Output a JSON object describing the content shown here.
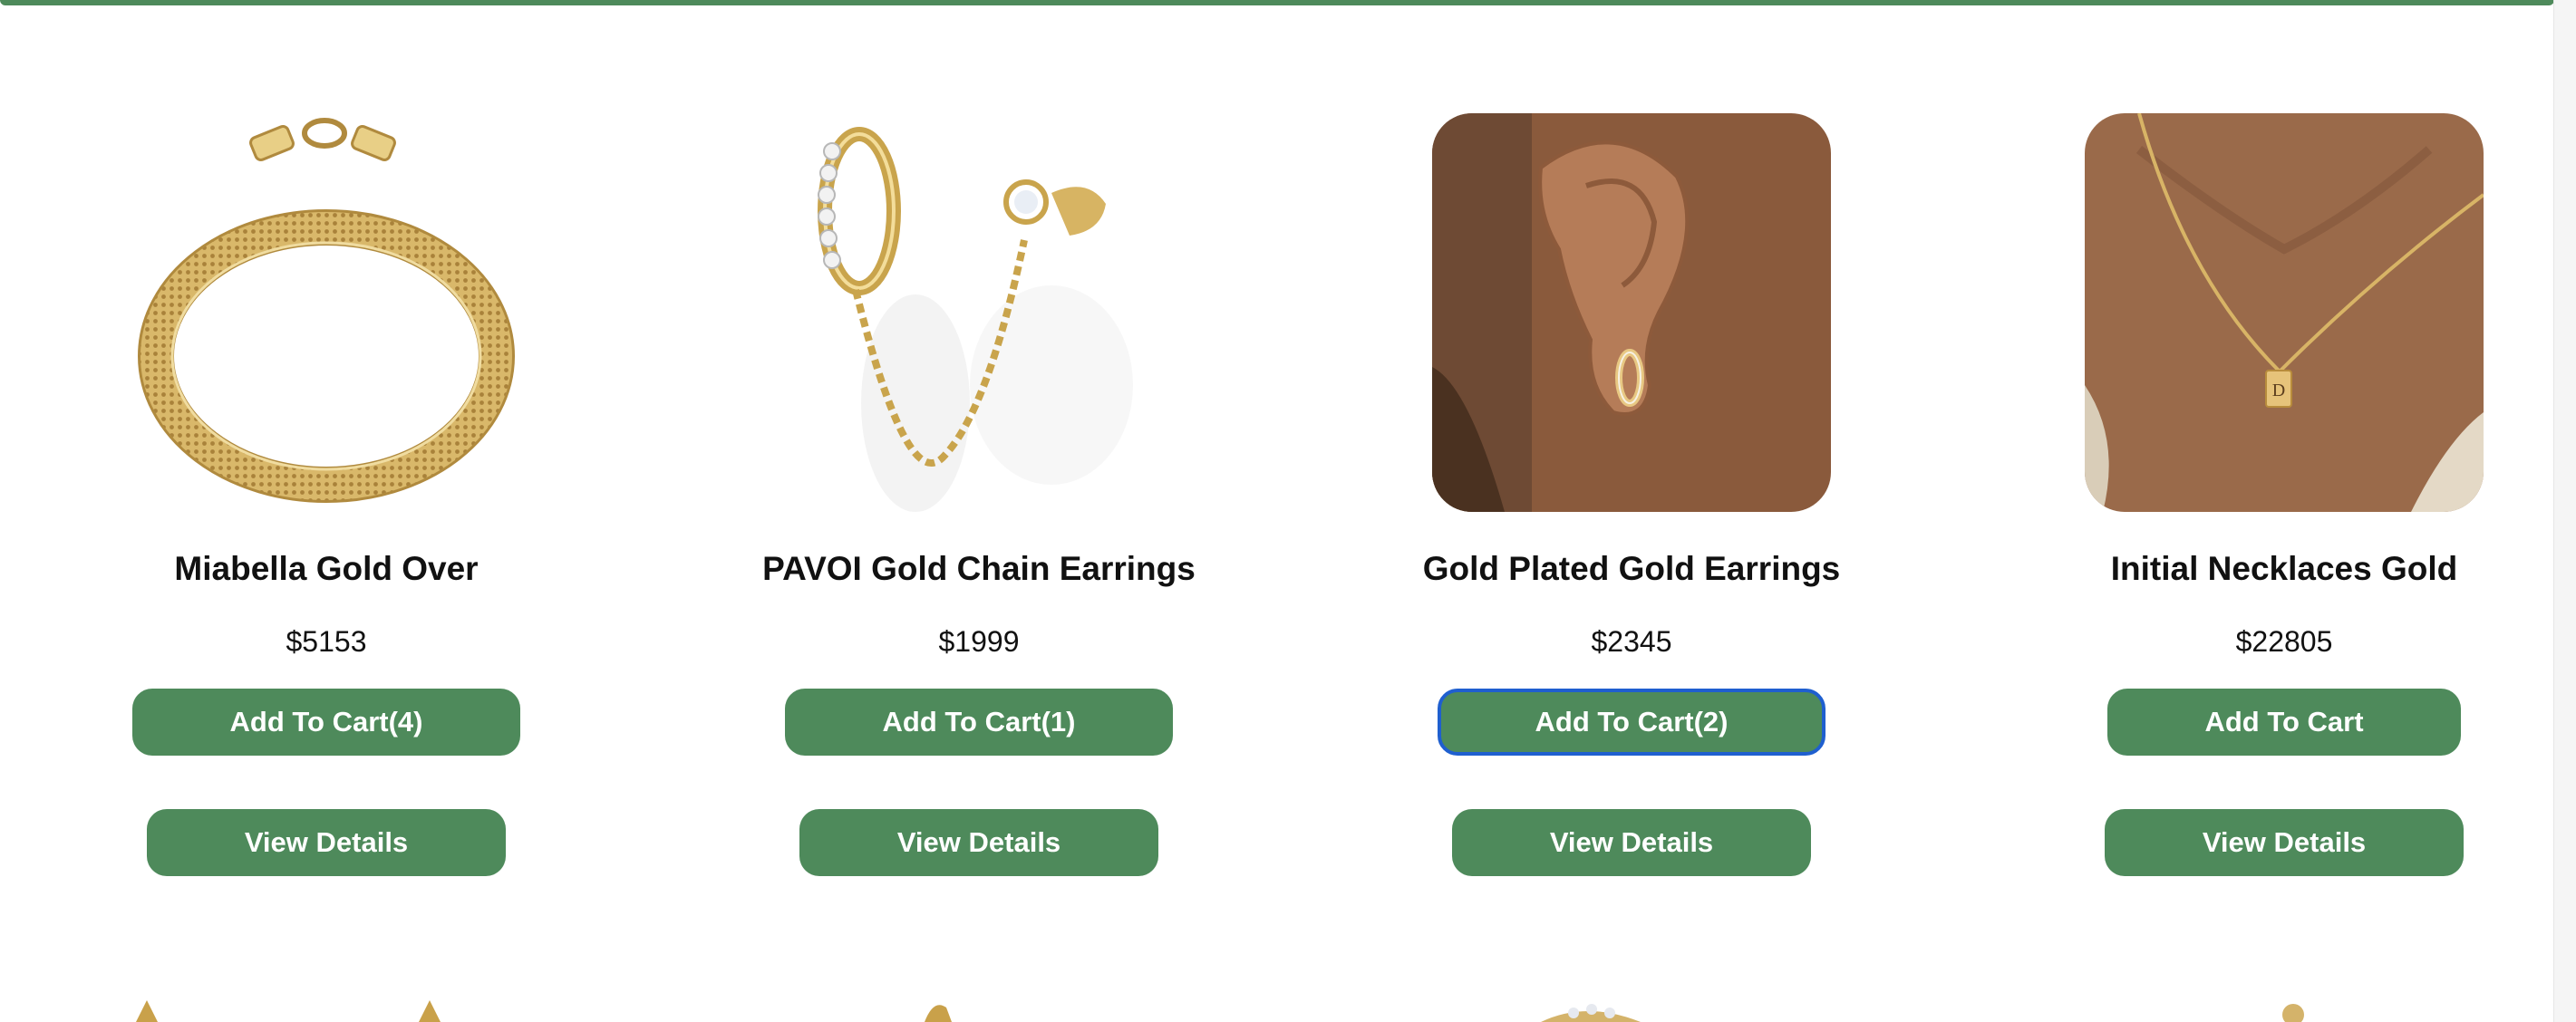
{
  "theme": {
    "accent": "#4e8a5b",
    "focus_ring": "#1f5fcf"
  },
  "products": [
    {
      "name": "Miabella Gold Over",
      "price": "$5153",
      "cart_label": "Add To Cart(4)",
      "details_label": "View Details",
      "image_icon": "gold-mesh-bracelet"
    },
    {
      "name": "PAVOI Gold Chain Earrings",
      "price": "$1999",
      "cart_label": "Add To Cart(1)",
      "details_label": "View Details",
      "image_icon": "gold-chain-earrings"
    },
    {
      "name": "Gold Plated Gold Earrings",
      "price": "$2345",
      "cart_label": "Add To Cart(2)",
      "details_label": "View Details",
      "image_icon": "ear-with-gold-hoop"
    },
    {
      "name": "Initial Necklaces Gold",
      "price": "$22805",
      "cart_label": "Add To Cart",
      "details_label": "View Details",
      "image_icon": "initial-necklace-on-neck"
    }
  ]
}
